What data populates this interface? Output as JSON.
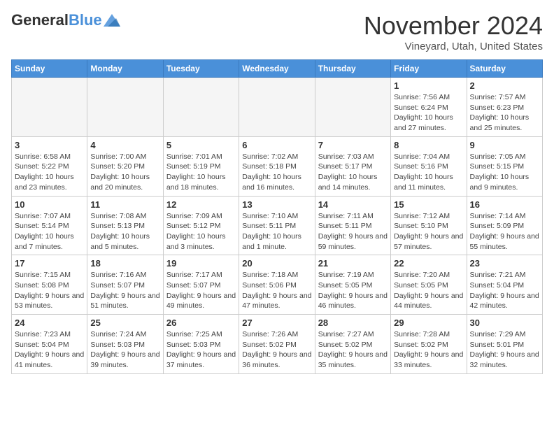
{
  "header": {
    "logo_general": "General",
    "logo_blue": "Blue",
    "month_title": "November 2024",
    "location": "Vineyard, Utah, United States"
  },
  "weekdays": [
    "Sunday",
    "Monday",
    "Tuesday",
    "Wednesday",
    "Thursday",
    "Friday",
    "Saturday"
  ],
  "weeks": [
    [
      {
        "day": "",
        "info": ""
      },
      {
        "day": "",
        "info": ""
      },
      {
        "day": "",
        "info": ""
      },
      {
        "day": "",
        "info": ""
      },
      {
        "day": "",
        "info": ""
      },
      {
        "day": "1",
        "info": "Sunrise: 7:56 AM\nSunset: 6:24 PM\nDaylight: 10 hours and 27 minutes."
      },
      {
        "day": "2",
        "info": "Sunrise: 7:57 AM\nSunset: 6:23 PM\nDaylight: 10 hours and 25 minutes."
      }
    ],
    [
      {
        "day": "3",
        "info": "Sunrise: 6:58 AM\nSunset: 5:22 PM\nDaylight: 10 hours and 23 minutes."
      },
      {
        "day": "4",
        "info": "Sunrise: 7:00 AM\nSunset: 5:20 PM\nDaylight: 10 hours and 20 minutes."
      },
      {
        "day": "5",
        "info": "Sunrise: 7:01 AM\nSunset: 5:19 PM\nDaylight: 10 hours and 18 minutes."
      },
      {
        "day": "6",
        "info": "Sunrise: 7:02 AM\nSunset: 5:18 PM\nDaylight: 10 hours and 16 minutes."
      },
      {
        "day": "7",
        "info": "Sunrise: 7:03 AM\nSunset: 5:17 PM\nDaylight: 10 hours and 14 minutes."
      },
      {
        "day": "8",
        "info": "Sunrise: 7:04 AM\nSunset: 5:16 PM\nDaylight: 10 hours and 11 minutes."
      },
      {
        "day": "9",
        "info": "Sunrise: 7:05 AM\nSunset: 5:15 PM\nDaylight: 10 hours and 9 minutes."
      }
    ],
    [
      {
        "day": "10",
        "info": "Sunrise: 7:07 AM\nSunset: 5:14 PM\nDaylight: 10 hours and 7 minutes."
      },
      {
        "day": "11",
        "info": "Sunrise: 7:08 AM\nSunset: 5:13 PM\nDaylight: 10 hours and 5 minutes."
      },
      {
        "day": "12",
        "info": "Sunrise: 7:09 AM\nSunset: 5:12 PM\nDaylight: 10 hours and 3 minutes."
      },
      {
        "day": "13",
        "info": "Sunrise: 7:10 AM\nSunset: 5:11 PM\nDaylight: 10 hours and 1 minute."
      },
      {
        "day": "14",
        "info": "Sunrise: 7:11 AM\nSunset: 5:11 PM\nDaylight: 9 hours and 59 minutes."
      },
      {
        "day": "15",
        "info": "Sunrise: 7:12 AM\nSunset: 5:10 PM\nDaylight: 9 hours and 57 minutes."
      },
      {
        "day": "16",
        "info": "Sunrise: 7:14 AM\nSunset: 5:09 PM\nDaylight: 9 hours and 55 minutes."
      }
    ],
    [
      {
        "day": "17",
        "info": "Sunrise: 7:15 AM\nSunset: 5:08 PM\nDaylight: 9 hours and 53 minutes."
      },
      {
        "day": "18",
        "info": "Sunrise: 7:16 AM\nSunset: 5:07 PM\nDaylight: 9 hours and 51 minutes."
      },
      {
        "day": "19",
        "info": "Sunrise: 7:17 AM\nSunset: 5:07 PM\nDaylight: 9 hours and 49 minutes."
      },
      {
        "day": "20",
        "info": "Sunrise: 7:18 AM\nSunset: 5:06 PM\nDaylight: 9 hours and 47 minutes."
      },
      {
        "day": "21",
        "info": "Sunrise: 7:19 AM\nSunset: 5:05 PM\nDaylight: 9 hours and 46 minutes."
      },
      {
        "day": "22",
        "info": "Sunrise: 7:20 AM\nSunset: 5:05 PM\nDaylight: 9 hours and 44 minutes."
      },
      {
        "day": "23",
        "info": "Sunrise: 7:21 AM\nSunset: 5:04 PM\nDaylight: 9 hours and 42 minutes."
      }
    ],
    [
      {
        "day": "24",
        "info": "Sunrise: 7:23 AM\nSunset: 5:04 PM\nDaylight: 9 hours and 41 minutes."
      },
      {
        "day": "25",
        "info": "Sunrise: 7:24 AM\nSunset: 5:03 PM\nDaylight: 9 hours and 39 minutes."
      },
      {
        "day": "26",
        "info": "Sunrise: 7:25 AM\nSunset: 5:03 PM\nDaylight: 9 hours and 37 minutes."
      },
      {
        "day": "27",
        "info": "Sunrise: 7:26 AM\nSunset: 5:02 PM\nDaylight: 9 hours and 36 minutes."
      },
      {
        "day": "28",
        "info": "Sunrise: 7:27 AM\nSunset: 5:02 PM\nDaylight: 9 hours and 35 minutes."
      },
      {
        "day": "29",
        "info": "Sunrise: 7:28 AM\nSunset: 5:02 PM\nDaylight: 9 hours and 33 minutes."
      },
      {
        "day": "30",
        "info": "Sunrise: 7:29 AM\nSunset: 5:01 PM\nDaylight: 9 hours and 32 minutes."
      }
    ]
  ]
}
